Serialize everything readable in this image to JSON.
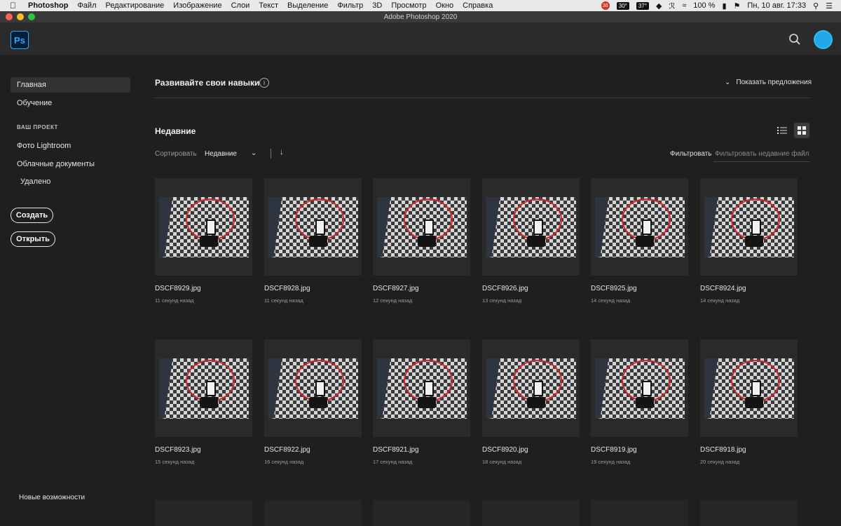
{
  "menubar": {
    "items": [
      "Photoshop",
      "Файл",
      "Редактирование",
      "Изображение",
      "Слои",
      "Текст",
      "Выделение",
      "Фильтр",
      "3D",
      "Просмотр",
      "Окно",
      "Справка"
    ],
    "status": {
      "notification_count": "36",
      "temp1": "30°",
      "temp2": "37°",
      "battery": "100 %",
      "datetime": "Пн, 10 авг.  17:33"
    }
  },
  "window": {
    "title": "Adobe Photoshop 2020"
  },
  "app": {
    "logo_text": "Ps"
  },
  "sidebar": {
    "home": "Главная",
    "learn": "Обучение",
    "project_heading": "ВАШ ПРОЕКТ",
    "lightroom": "Фото Lightroom",
    "cloud_docs": "Облачные документы",
    "deleted": "Удалено",
    "create_label": "Создать",
    "open_label": "Открыть",
    "whats_new": "Новые возможности"
  },
  "skills": {
    "title": "Развивайте свои навыки",
    "show_suggestions": "Показать предложения"
  },
  "recent": {
    "title": "Недавние",
    "sort_label": "Сортировать",
    "sort_value": "Недавние",
    "filter_label": "Фильтровать",
    "filter_placeholder": "Фильтровать недавние файлы",
    "files": [
      {
        "name": "DSCF8929.jpg",
        "time": "11 секунд назад"
      },
      {
        "name": "DSCF8928.jpg",
        "time": "11 секунд назад"
      },
      {
        "name": "DSCF8927.jpg",
        "time": "12 секунд назад"
      },
      {
        "name": "DSCF8926.jpg",
        "time": "13 секунд назад"
      },
      {
        "name": "DSCF8925.jpg",
        "time": "14 секунд назад"
      },
      {
        "name": "DSCF8924.jpg",
        "time": "14 секунд назад"
      },
      {
        "name": "DSCF8923.jpg",
        "time": "15 секунд назад"
      },
      {
        "name": "DSCF8922.jpg",
        "time": "16 секунд назад"
      },
      {
        "name": "DSCF8921.jpg",
        "time": "17 секунд назад"
      },
      {
        "name": "DSCF8920.jpg",
        "time": "18 секунд назад"
      },
      {
        "name": "DSCF8919.jpg",
        "time": "19 секунд назад"
      },
      {
        "name": "DSCF8918.jpg",
        "time": "20 секунд назад"
      }
    ]
  }
}
